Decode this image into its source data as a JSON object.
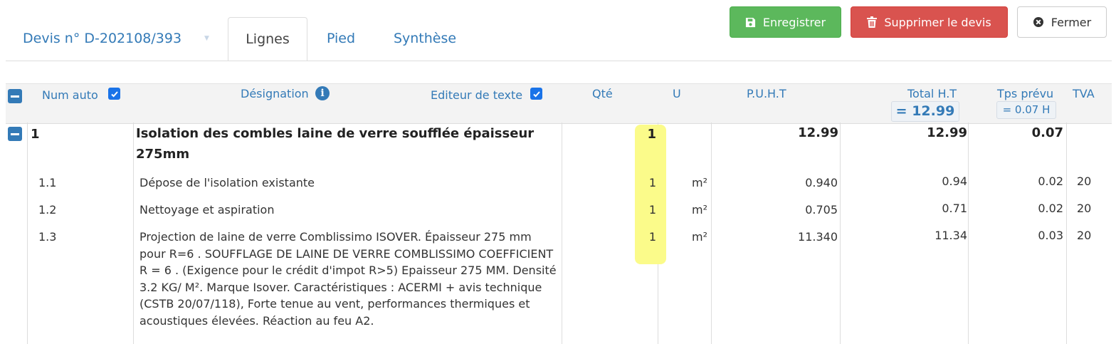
{
  "header": {
    "doc_title": "Devis n° D-202108/393",
    "tabs": [
      {
        "label": "Lignes",
        "active": true
      },
      {
        "label": "Pied",
        "active": false
      },
      {
        "label": "Synthèse",
        "active": false
      }
    ],
    "buttons": {
      "save": "Enregistrer",
      "delete": "Supprimer le devis",
      "close": "Fermer"
    }
  },
  "table": {
    "columns": {
      "num_auto": "Num auto",
      "designation": "Désignation",
      "editeur": "Editeur de texte",
      "qte": "Qté",
      "unite": "U",
      "puht": "P.U.H.T",
      "total_ht": "Total H.T",
      "tps_prevu": "Tps prévu",
      "tva": "TVA"
    },
    "num_auto_checked": true,
    "editeur_checked": true,
    "totals": {
      "total_ht": "= 12.99",
      "tps_prevu": "= 0.07 H"
    },
    "group": {
      "num": "1",
      "title": "Isolation des combles laine de verre soufflée épaisseur 275mm",
      "qte": "1",
      "puht": "12.99",
      "total_ht": "12.99",
      "tps": "0.07"
    },
    "lines": [
      {
        "num": "1.1",
        "designation": "Dépose de l'isolation existante",
        "qte": "1",
        "unite": "m²",
        "puht": "0.940",
        "total_ht": "0.94",
        "tps": "0.02",
        "tva": "20"
      },
      {
        "num": "1.2",
        "designation": "Nettoyage et aspiration",
        "qte": "1",
        "unite": "m²",
        "puht": "0.705",
        "total_ht": "0.71",
        "tps": "0.02",
        "tva": "20"
      },
      {
        "num": "1.3",
        "designation": "Projection de laine de verre Comblissimo ISOVER. Épaisseur 275 mm pour R=6 . SOUFFLAGE DE LAINE DE VERRE COMBLISSIMO COEFFICIENT R = 6 . (Exigence pour le crédit d'impot R>5) Epaisseur 275 MM. Densité 3.2 KG/ M². Marque Isover. Caractéristiques : ACERMI + avis technique (CSTB 20/07/118), Forte tenue au vent, performances thermiques et acoustiques élevées. Réaction au feu A2.",
        "qte": "1",
        "unite": "m²",
        "puht": "11.340",
        "total_ht": "11.34",
        "tps": "0.03",
        "tva": "20"
      }
    ]
  },
  "colors": {
    "primary": "#337ab7",
    "success": "#5cb85c",
    "danger": "#d9534f",
    "highlight": "#fbfb8a"
  }
}
